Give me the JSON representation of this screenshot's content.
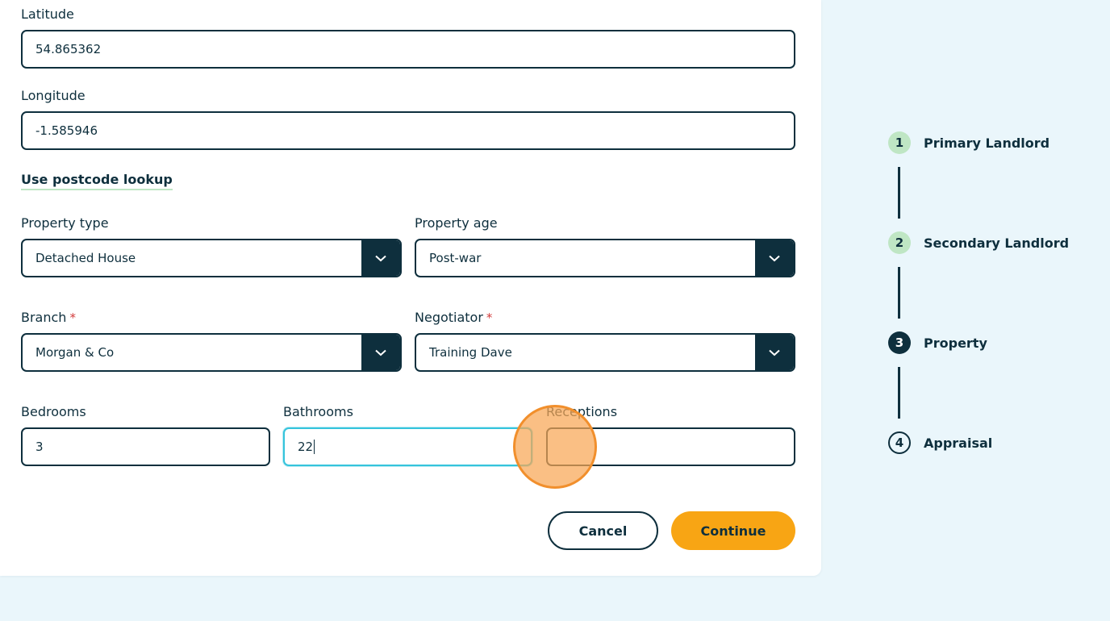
{
  "form": {
    "latitude": {
      "label": "Latitude",
      "value": "54.865362"
    },
    "longitude": {
      "label": "Longitude",
      "value": "-1.585946"
    },
    "postcode_link": "Use postcode lookup",
    "property_type": {
      "label": "Property type",
      "value": "Detached House"
    },
    "property_age": {
      "label": "Property age",
      "value": "Post-war"
    },
    "branch": {
      "label": "Branch",
      "required_mark": "*",
      "value": "Morgan & Co"
    },
    "negotiator": {
      "label": "Negotiator",
      "required_mark": "*",
      "value": "Training Dave"
    },
    "bedrooms": {
      "label": "Bedrooms",
      "value": "3"
    },
    "bathrooms": {
      "label": "Bathrooms",
      "value": "22"
    },
    "receptions": {
      "label": "Receptions",
      "value": ""
    }
  },
  "actions": {
    "cancel_label": "Cancel",
    "continue_label": "Continue"
  },
  "stepper": {
    "steps": [
      {
        "number": "1",
        "label": "Primary Landlord",
        "status": "complete"
      },
      {
        "number": "2",
        "label": "Secondary Landlord",
        "status": "complete"
      },
      {
        "number": "3",
        "label": "Property",
        "status": "current"
      },
      {
        "number": "4",
        "label": "Appraisal",
        "status": "upcoming"
      }
    ]
  },
  "colors": {
    "primary": "#0e2f3d",
    "accent": "#f8a514",
    "focus": "#35c4dc",
    "step_complete": "#bfe6c4",
    "background": "#eaf6fb"
  },
  "icons": {
    "select_chevron": "chevron-down-icon"
  }
}
